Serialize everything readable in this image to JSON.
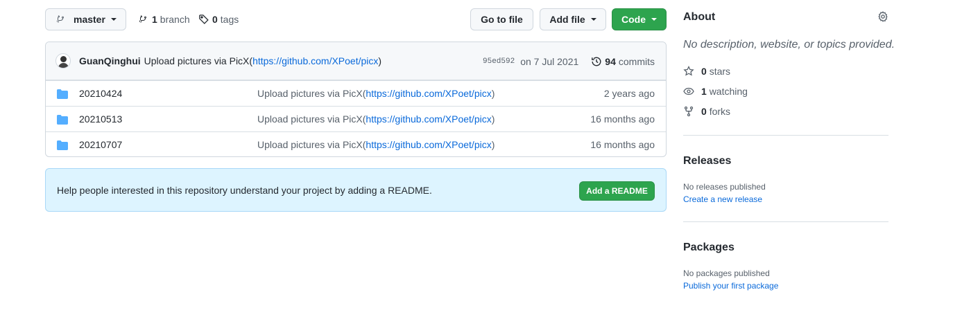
{
  "toolbar": {
    "branch_name": "master",
    "branch_count": "1",
    "branch_label": "branch",
    "tag_count": "0",
    "tag_label": "tags",
    "go_to_file": "Go to file",
    "add_file": "Add file",
    "code": "Code"
  },
  "commit": {
    "author": "GuanQinghui",
    "message_prefix": "Upload pictures via PicX(",
    "link": "https://github.com/XPoet/picx",
    "message_suffix": ")",
    "sha": "95ed592",
    "date": "on 7 Jul 2021",
    "count": "94",
    "count_label": "commits"
  },
  "files": [
    {
      "name": "20210424",
      "msg_prefix": "Upload pictures via PicX(",
      "link": "https://github.com/XPoet/picx",
      "msg_suffix": ")",
      "age": "2 years ago"
    },
    {
      "name": "20210513",
      "msg_prefix": "Upload pictures via PicX(",
      "link": "https://github.com/XPoet/picx",
      "msg_suffix": ")",
      "age": "16 months ago"
    },
    {
      "name": "20210707",
      "msg_prefix": "Upload pictures via PicX(",
      "link": "https://github.com/XPoet/picx",
      "msg_suffix": ")",
      "age": "16 months ago"
    }
  ],
  "readme": {
    "text": "Help people interested in this repository understand your project by adding a README.",
    "button": "Add a README"
  },
  "about": {
    "title": "About",
    "description": "No description, website, or topics provided.",
    "stars_count": "0",
    "stars_label": "stars",
    "watching_count": "1",
    "watching_label": "watching",
    "forks_count": "0",
    "forks_label": "forks"
  },
  "releases": {
    "title": "Releases",
    "none_text": "No releases published",
    "create_link": "Create a new release"
  },
  "packages": {
    "title": "Packages",
    "none_text": "No packages published",
    "publish_link": "Publish your first package"
  },
  "colors": {
    "accent_green": "#2da44e",
    "link_blue": "#0969da",
    "folder_blue": "#54aeff",
    "banner_bg": "#ddf4ff"
  }
}
